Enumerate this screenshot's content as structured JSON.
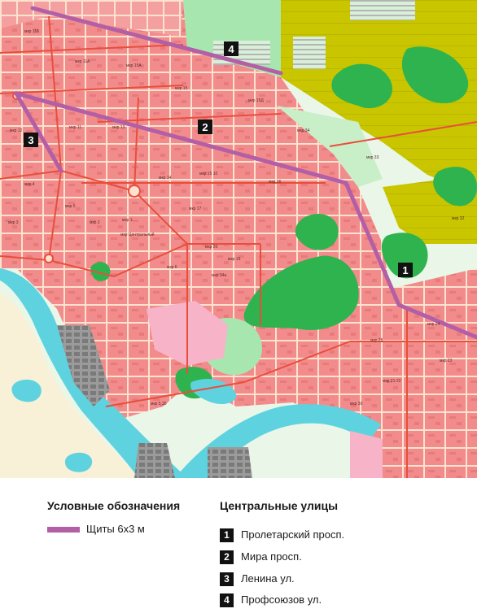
{
  "legend": {
    "symbols_title": "Условные обозначения",
    "billboard_label": "Щиты 6х3 м",
    "route_color": "#b35fa6",
    "streets_title": "Центральные улицы",
    "streets": [
      {
        "num": "1",
        "name": "Пролетарский просп."
      },
      {
        "num": "2",
        "name": "Мира просп."
      },
      {
        "num": "3",
        "name": "Ленина ул."
      },
      {
        "num": "4",
        "name": "Профсоюзов ул."
      }
    ]
  },
  "map": {
    "markers": [
      "1",
      "2",
      "3",
      "4"
    ],
    "district_labels": [
      "мкр 11Б",
      "мкр 11А",
      "мкр 15А",
      "мкр 15Д",
      "мкр 15",
      "мкр 34",
      "мкр 33",
      "мкр 11",
      "мкр 12",
      "мкр 13",
      "мкр 14",
      "мкр 15 10",
      "мкр 16",
      "мкр 17",
      "мкр 20",
      "мкр 19",
      "мкр 24",
      "мкр 25",
      "мкр 23",
      "мкр 21-22",
      "мкр 30",
      "мкр 32",
      "мкр 4",
      "мкр 5",
      "мкр 3",
      "мкр 2",
      "мкр 1",
      "мкр 5 30",
      "мкр Центральный",
      "мкр 6",
      "мкр 14а"
    ],
    "colors": {
      "residential": "#f28c8c",
      "street": "#fde3cf",
      "arterial": "#e84e3c",
      "forest": "#2fb34f",
      "park": "#a8e6b0",
      "agri": "#c9c600",
      "water": "#5ed3df",
      "industrial": "#8a8a8a"
    }
  }
}
